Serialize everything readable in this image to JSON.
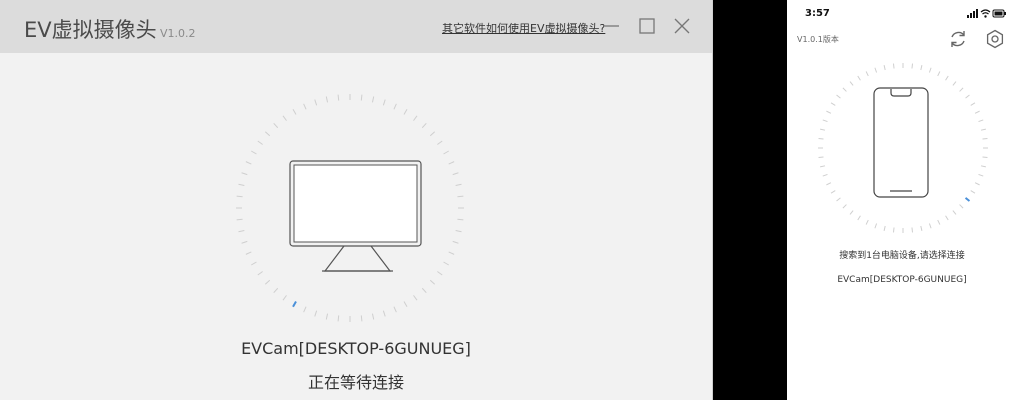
{
  "desktop_app": {
    "title": "EV虚拟摄像头",
    "version": "V1.0.2",
    "help_link": "其它软件如何使用EV虚拟摄像头?",
    "device_name": "EVCam[DESKTOP-6GUNUEG]",
    "status": "正在等待连接",
    "accent_color": "#4a90d9"
  },
  "mobile_app": {
    "time": "3:57",
    "version": "V1.0.1版本",
    "found_message": "搜索到1台电脑设备,请选择连接",
    "device_item": "EVCam[DESKTOP-6GUNUEG]",
    "accent_color": "#4a90d9"
  },
  "icons": [
    "minimize-icon",
    "maximize-icon",
    "close-icon",
    "refresh-icon",
    "settings-icon",
    "monitor-icon",
    "phone-icon",
    "signal-icon",
    "wifi-icon",
    "battery-icon"
  ]
}
